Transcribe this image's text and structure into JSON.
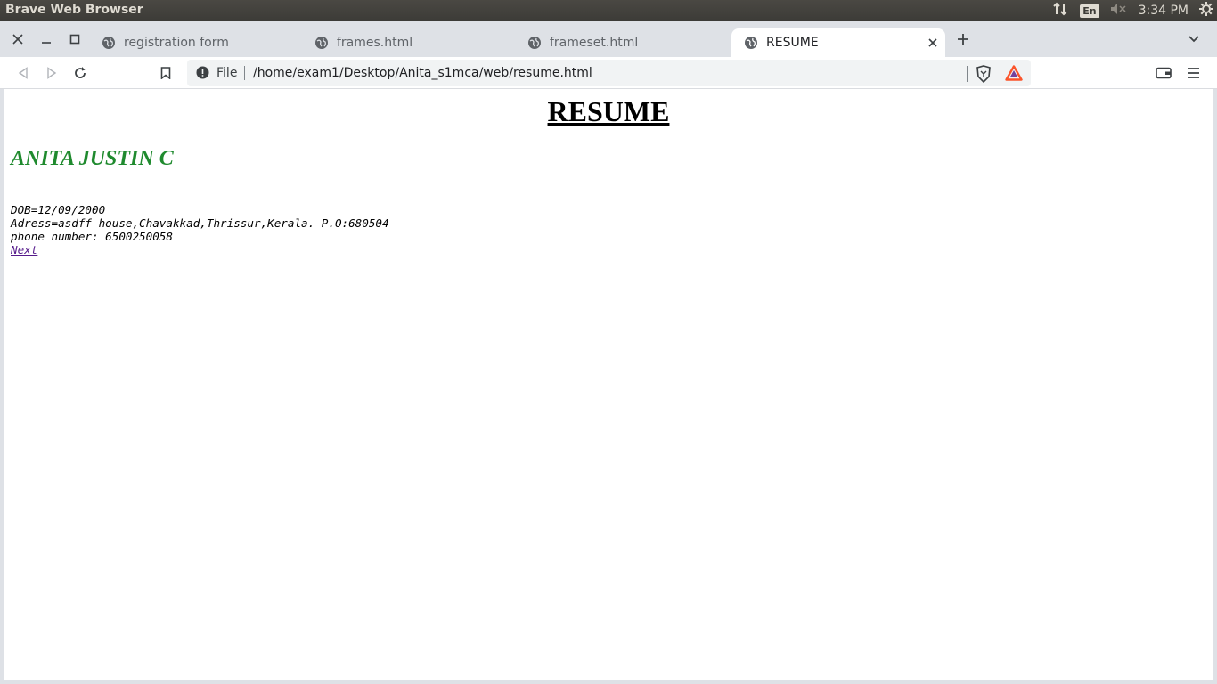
{
  "system_bar": {
    "app_title": "Brave Web Browser",
    "lang": "En",
    "time": "3:34 PM"
  },
  "tabs": [
    {
      "label": "registration form",
      "active": false
    },
    {
      "label": "frames.html",
      "active": false
    },
    {
      "label": "frameset.html",
      "active": false
    },
    {
      "label": "RESUME",
      "active": true
    }
  ],
  "toolbar": {
    "scheme": "File",
    "url": "/home/exam1/Desktop/Anita_s1mca/web/resume.html"
  },
  "page": {
    "heading": "RESUME",
    "name": "ANITA JUSTIN C",
    "dob": "DOB=12/09/2000",
    "address": "Adress=asdff house,Chavakkad,Thrissur,Kerala. P.O:680504",
    "phone": "phone number: 6500250058",
    "next_link": "Next"
  },
  "colors": {
    "name_color": "#1f8a2e",
    "link_visited": "#551a8b",
    "brave_orange": "#fb542b"
  }
}
